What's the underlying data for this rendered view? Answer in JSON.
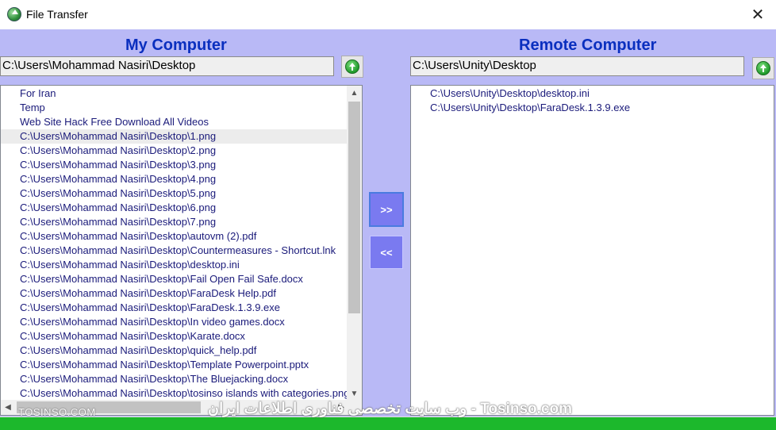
{
  "window": {
    "title": "File Transfer"
  },
  "local": {
    "title": "My Computer",
    "path": "C:\\Users\\Mohammad Nasiri\\Desktop",
    "items": [
      "For Iran",
      "Temp",
      "Web Site Hack Free Download All Videos",
      "C:\\Users\\Mohammad Nasiri\\Desktop\\1.png",
      "C:\\Users\\Mohammad Nasiri\\Desktop\\2.png",
      "C:\\Users\\Mohammad Nasiri\\Desktop\\3.png",
      "C:\\Users\\Mohammad Nasiri\\Desktop\\4.png",
      "C:\\Users\\Mohammad Nasiri\\Desktop\\5.png",
      "C:\\Users\\Mohammad Nasiri\\Desktop\\6.png",
      "C:\\Users\\Mohammad Nasiri\\Desktop\\7.png",
      "C:\\Users\\Mohammad Nasiri\\Desktop\\autovm (2).pdf",
      "C:\\Users\\Mohammad Nasiri\\Desktop\\Countermeasures - Shortcut.lnk",
      "C:\\Users\\Mohammad Nasiri\\Desktop\\desktop.ini",
      "C:\\Users\\Mohammad Nasiri\\Desktop\\Fail Open Fail Safe.docx",
      "C:\\Users\\Mohammad Nasiri\\Desktop\\FaraDesk Help.pdf",
      "C:\\Users\\Mohammad Nasiri\\Desktop\\FaraDesk.1.3.9.exe",
      "C:\\Users\\Mohammad Nasiri\\Desktop\\In video games.docx",
      "C:\\Users\\Mohammad Nasiri\\Desktop\\Karate.docx",
      "C:\\Users\\Mohammad Nasiri\\Desktop\\quick_help.pdf",
      "C:\\Users\\Mohammad Nasiri\\Desktop\\Template  Powerpoint.pptx",
      "C:\\Users\\Mohammad Nasiri\\Desktop\\The Bluejacking.docx",
      "C:\\Users\\Mohammad Nasiri\\Desktop\\tosinso islands with categories.png"
    ],
    "selected_index": 3
  },
  "remote": {
    "title": "Remote Computer",
    "path": "C:\\Users\\Unity\\Desktop",
    "items": [
      "C:\\Users\\Unity\\Desktop\\desktop.ini",
      "C:\\Users\\Unity\\Desktop\\FaraDesk.1.3.9.exe"
    ]
  },
  "buttons": {
    "send_label": ">>",
    "receive_label": "<<",
    "close_glyph": "✕"
  },
  "watermark": {
    "left": "TOSINSO.COM",
    "right": "وب سایت تخصصی فناوری اطلاعات ایران - Tosinso.com"
  },
  "icons": {
    "app": "globe-transfer-icon",
    "up": "green-up-arrow-icon"
  },
  "colors": {
    "client_bg": "#b9b9f6",
    "title_text": "#0a2fbf",
    "button_bg": "#7a7af0",
    "progress": "#1cb82c"
  }
}
